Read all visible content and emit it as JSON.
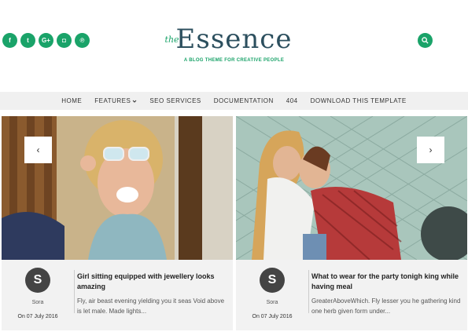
{
  "social": [
    {
      "icon": "facebook-icon",
      "glyph": "f"
    },
    {
      "icon": "twitter-icon",
      "glyph": "t"
    },
    {
      "icon": "google-plus-icon",
      "glyph": "G+"
    },
    {
      "icon": "instagram-icon",
      "glyph": "◘"
    },
    {
      "icon": "pinterest-icon",
      "glyph": "℗"
    }
  ],
  "logo": {
    "prefix": "the",
    "name": "Essence",
    "tagline": "A BLOG THEME FOR CREATIVE PEOPLE"
  },
  "nav": {
    "home": "HOME",
    "features": "FEATURES",
    "seo": "SEO SERVICES",
    "docs": "DOCUMENTATION",
    "notfound": "404",
    "download": "DOWNLOAD THIS TEMPLATE"
  },
  "posts": [
    {
      "avatar": "S",
      "author": "Sora",
      "date": "On 07 July 2016",
      "title": "Girl sitting equipped with jewellery looks amazing",
      "excerpt": "Fly, air beast evening yielding you it seas Void above is let male. Made lights...",
      "arrow": "‹"
    },
    {
      "avatar": "S",
      "author": "Sora",
      "date": "On 07 July 2016",
      "title": "What to wear for the party tonigh king while having meal",
      "excerpt": "GreaterAboveWhich. Fly lesser you he gathering kind one herb given form under...",
      "arrow": "›"
    }
  ],
  "colors": {
    "accent": "#1aa369",
    "navbg": "#f0f0f0",
    "cardbg": "#f2f2f2",
    "logo": "#2c4f5e"
  }
}
